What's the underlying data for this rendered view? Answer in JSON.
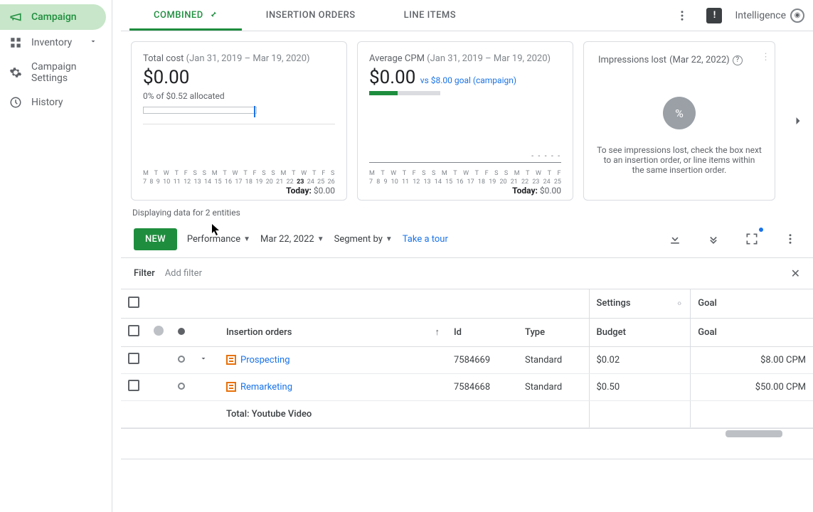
{
  "sidebar": {
    "items": [
      {
        "label": "Campaign"
      },
      {
        "label": "Inventory"
      },
      {
        "label": "Campaign Settings"
      },
      {
        "label": "History"
      }
    ]
  },
  "tabs": {
    "combined": "COMBINED",
    "insertion_orders": "INSERTION ORDERS",
    "line_items": "LINE ITEMS"
  },
  "top": {
    "intelligence": "Intelligence"
  },
  "cards": {
    "totalCost": {
      "title": "Total cost",
      "range": "(Jan 31, 2019 – Mar 19, 2020)",
      "value": "$0.00",
      "sub": "0% of $0.52 allocated",
      "days": "M T W T F S S M T W T F S S M T W T F S",
      "dates": [
        "7",
        "8",
        "9",
        "10",
        "11",
        "12",
        "13",
        "14",
        "15",
        "16",
        "17",
        "18",
        "19",
        "20",
        "21",
        "22",
        "23",
        "24",
        "25",
        "26"
      ],
      "today_label": "Today:",
      "today_value": "$0.00"
    },
    "avgCpm": {
      "title": "Average CPM",
      "range": "(Jan 31, 2019 – Mar 19, 2020)",
      "value": "$0.00",
      "vs": "vs $8.00 goal (campaign)",
      "days": "M T W T F S S M T W T F S S M T W T F S",
      "dates": [
        "7",
        "8",
        "9",
        "10",
        "11",
        "12",
        "13",
        "14",
        "15",
        "16",
        "17",
        "18",
        "19",
        "20",
        "21",
        "22",
        "23",
        "24",
        "25"
      ],
      "today_label": "Today:",
      "today_value": "$0.00"
    },
    "impLost": {
      "title": "Impressions lost",
      "range": "(Mar 22, 2022)",
      "pct": "%",
      "text": "To see impressions lost, check the box next to an insertion order, or line items within the same insertion order."
    }
  },
  "display_text": "Displaying data for 2 entities",
  "toolbar": {
    "new": "NEW",
    "performance": "Performance",
    "date": "Mar 22, 2022",
    "segment": "Segment by",
    "tour": "Take a tour"
  },
  "filter": {
    "label": "Filter",
    "add": "Add filter"
  },
  "table": {
    "groups": {
      "settings": "Settings",
      "goal": "Goal"
    },
    "cols": {
      "name": "Insertion orders",
      "id": "Id",
      "type": "Type",
      "budget": "Budget",
      "goal": "Goal"
    },
    "rows": [
      {
        "name": "Prospecting",
        "id": "7584669",
        "type": "Standard",
        "budget": "$0.02",
        "goal": "$8.00 CPM"
      },
      {
        "name": "Remarketing",
        "id": "7584668",
        "type": "Standard",
        "budget": "$0.50",
        "goal": "$50.00 CPM"
      }
    ],
    "total": "Total: Youtube Video"
  }
}
